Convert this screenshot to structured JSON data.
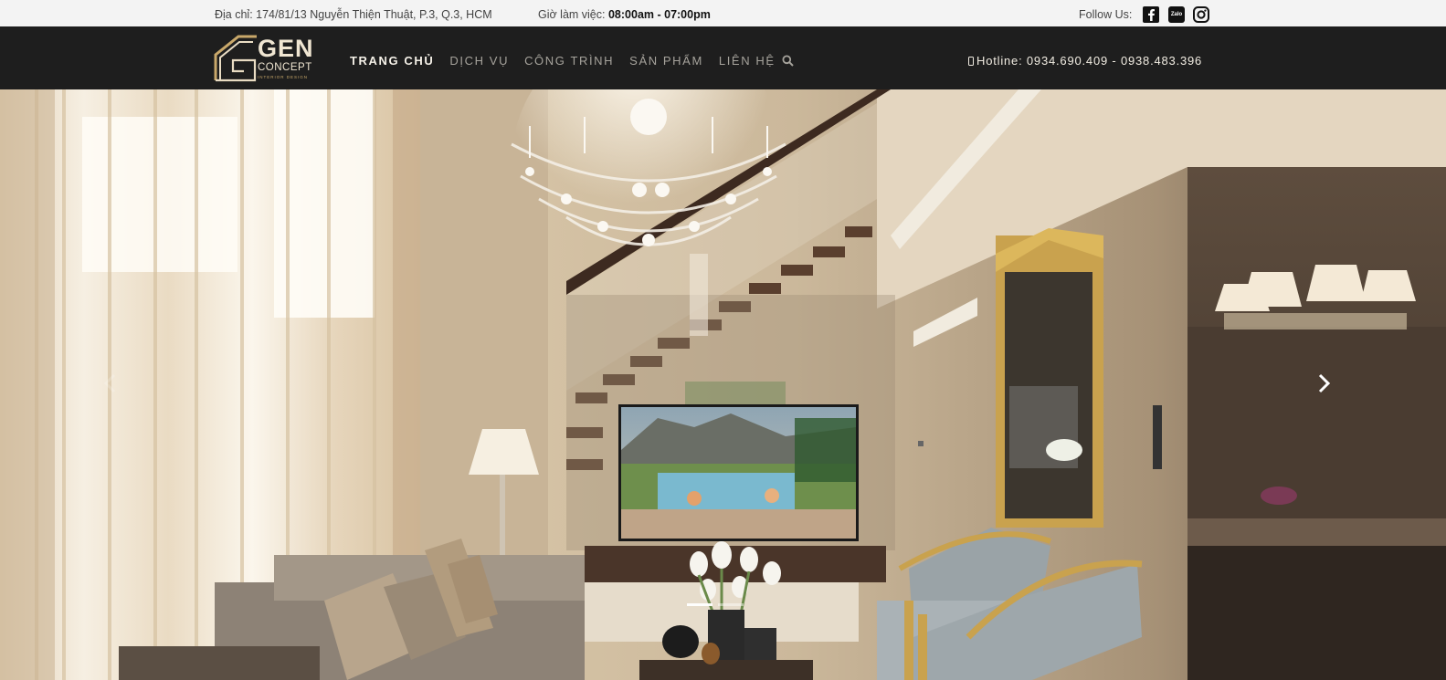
{
  "topbar": {
    "address": "Địa chỉ: 174/81/13 Nguyễn Thiện Thuật, P.3, Q.3, HCM",
    "hours_label": "Giờ làm việc: ",
    "hours_value": "08:00am - 07:00pm",
    "follow_label": "Follow Us:",
    "socials": [
      {
        "icon": "facebook-icon"
      },
      {
        "icon": "zalo-icon",
        "text": "Zalo"
      },
      {
        "icon": "instagram-icon"
      }
    ]
  },
  "header": {
    "logo": {
      "word1": "GEN",
      "word2": "CONCEPT",
      "tagline": "INTERIOR DESIGN",
      "accent": "#c9a86a"
    },
    "nav": [
      {
        "label": "TRANG CHỦ",
        "active": true
      },
      {
        "label": "DỊCH VỤ",
        "active": false
      },
      {
        "label": "CÔNG TRÌNH",
        "active": false
      },
      {
        "label": "SẢN PHẨM",
        "active": false
      },
      {
        "label": "LIÊN HỆ",
        "active": false
      }
    ],
    "search_icon": "search-icon",
    "hotline": "Hotline: 0934.690.409 - 0938.483.396"
  },
  "hero": {
    "prev_icon": "chevron-left-icon",
    "next_icon": "chevron-right-icon",
    "slide_count": 2,
    "active_slide": 1
  },
  "colors": {
    "header_bg": "#1e1e1e",
    "topbar_bg": "#f3f3f3",
    "brand_gold": "#c9a86a"
  }
}
